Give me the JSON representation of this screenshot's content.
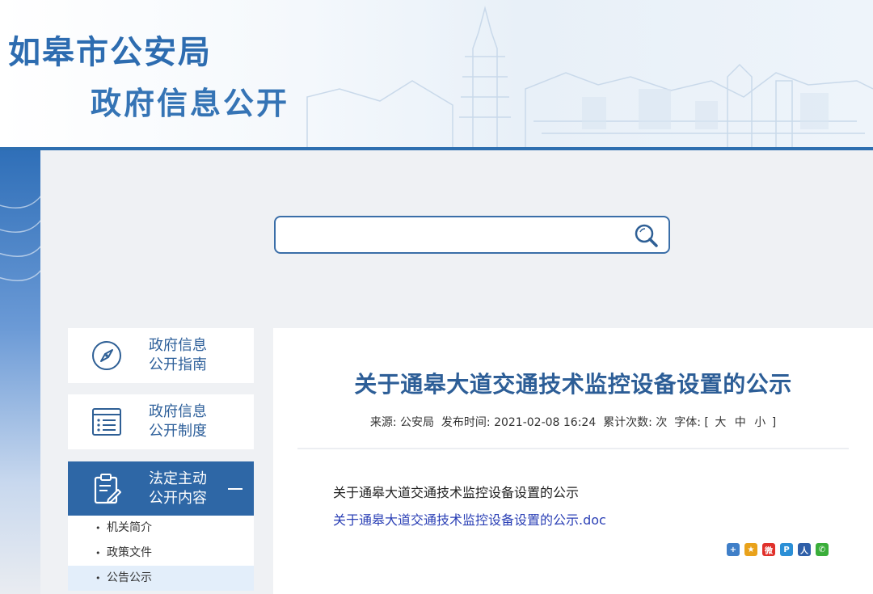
{
  "header": {
    "title": "如皋市公安局",
    "subtitle": "政府信息公开"
  },
  "search": {
    "placeholder": "",
    "value": "",
    "icon": "search-icon"
  },
  "sidebar": {
    "items": [
      {
        "line1": "政府信息",
        "line2": "公开指南",
        "icon": "compass-icon"
      },
      {
        "line1": "政府信息",
        "line2": "公开制度",
        "icon": "list-icon"
      },
      {
        "line1": "法定主动",
        "line2": "公开内容",
        "icon": "clipboard-edit-icon",
        "active": true
      }
    ],
    "subitems": [
      {
        "label": "机关简介"
      },
      {
        "label": "政策文件"
      },
      {
        "label": "公告公示",
        "current": true
      }
    ]
  },
  "article": {
    "title": "关于通皋大道交通技术监控设备设置的公示",
    "meta": {
      "source": "来源: 公安局",
      "published": "发布时间: 2021-02-08 16:24",
      "views": "累计次数:  次",
      "font_label": "字体:",
      "font_open": "[",
      "font_large": "大",
      "font_medium": "中",
      "font_small": "小",
      "font_close": "]"
    },
    "body_text": "关于通皋大道交通技术监控设备设置的公示",
    "attachment": "关于通皋大道交通技术监控设备设置的公示.doc"
  },
  "share": [
    {
      "name": "share-plus-icon",
      "glyph": "+",
      "color": "#3f7fc8"
    },
    {
      "name": "qzone-icon",
      "glyph": "★",
      "color": "#e9a21b"
    },
    {
      "name": "weibo-icon",
      "glyph": "微",
      "color": "#e0312b"
    },
    {
      "name": "tencent-weibo-icon",
      "glyph": "P",
      "color": "#2b8fd6"
    },
    {
      "name": "renren-icon",
      "glyph": "人",
      "color": "#2f5fa8"
    },
    {
      "name": "wechat-icon",
      "glyph": "✆",
      "color": "#3aae3a"
    }
  ],
  "colors": {
    "brand_blue": "#2e67a6",
    "title_blue": "#2d5e97",
    "link_blue": "#2a3fb5"
  }
}
